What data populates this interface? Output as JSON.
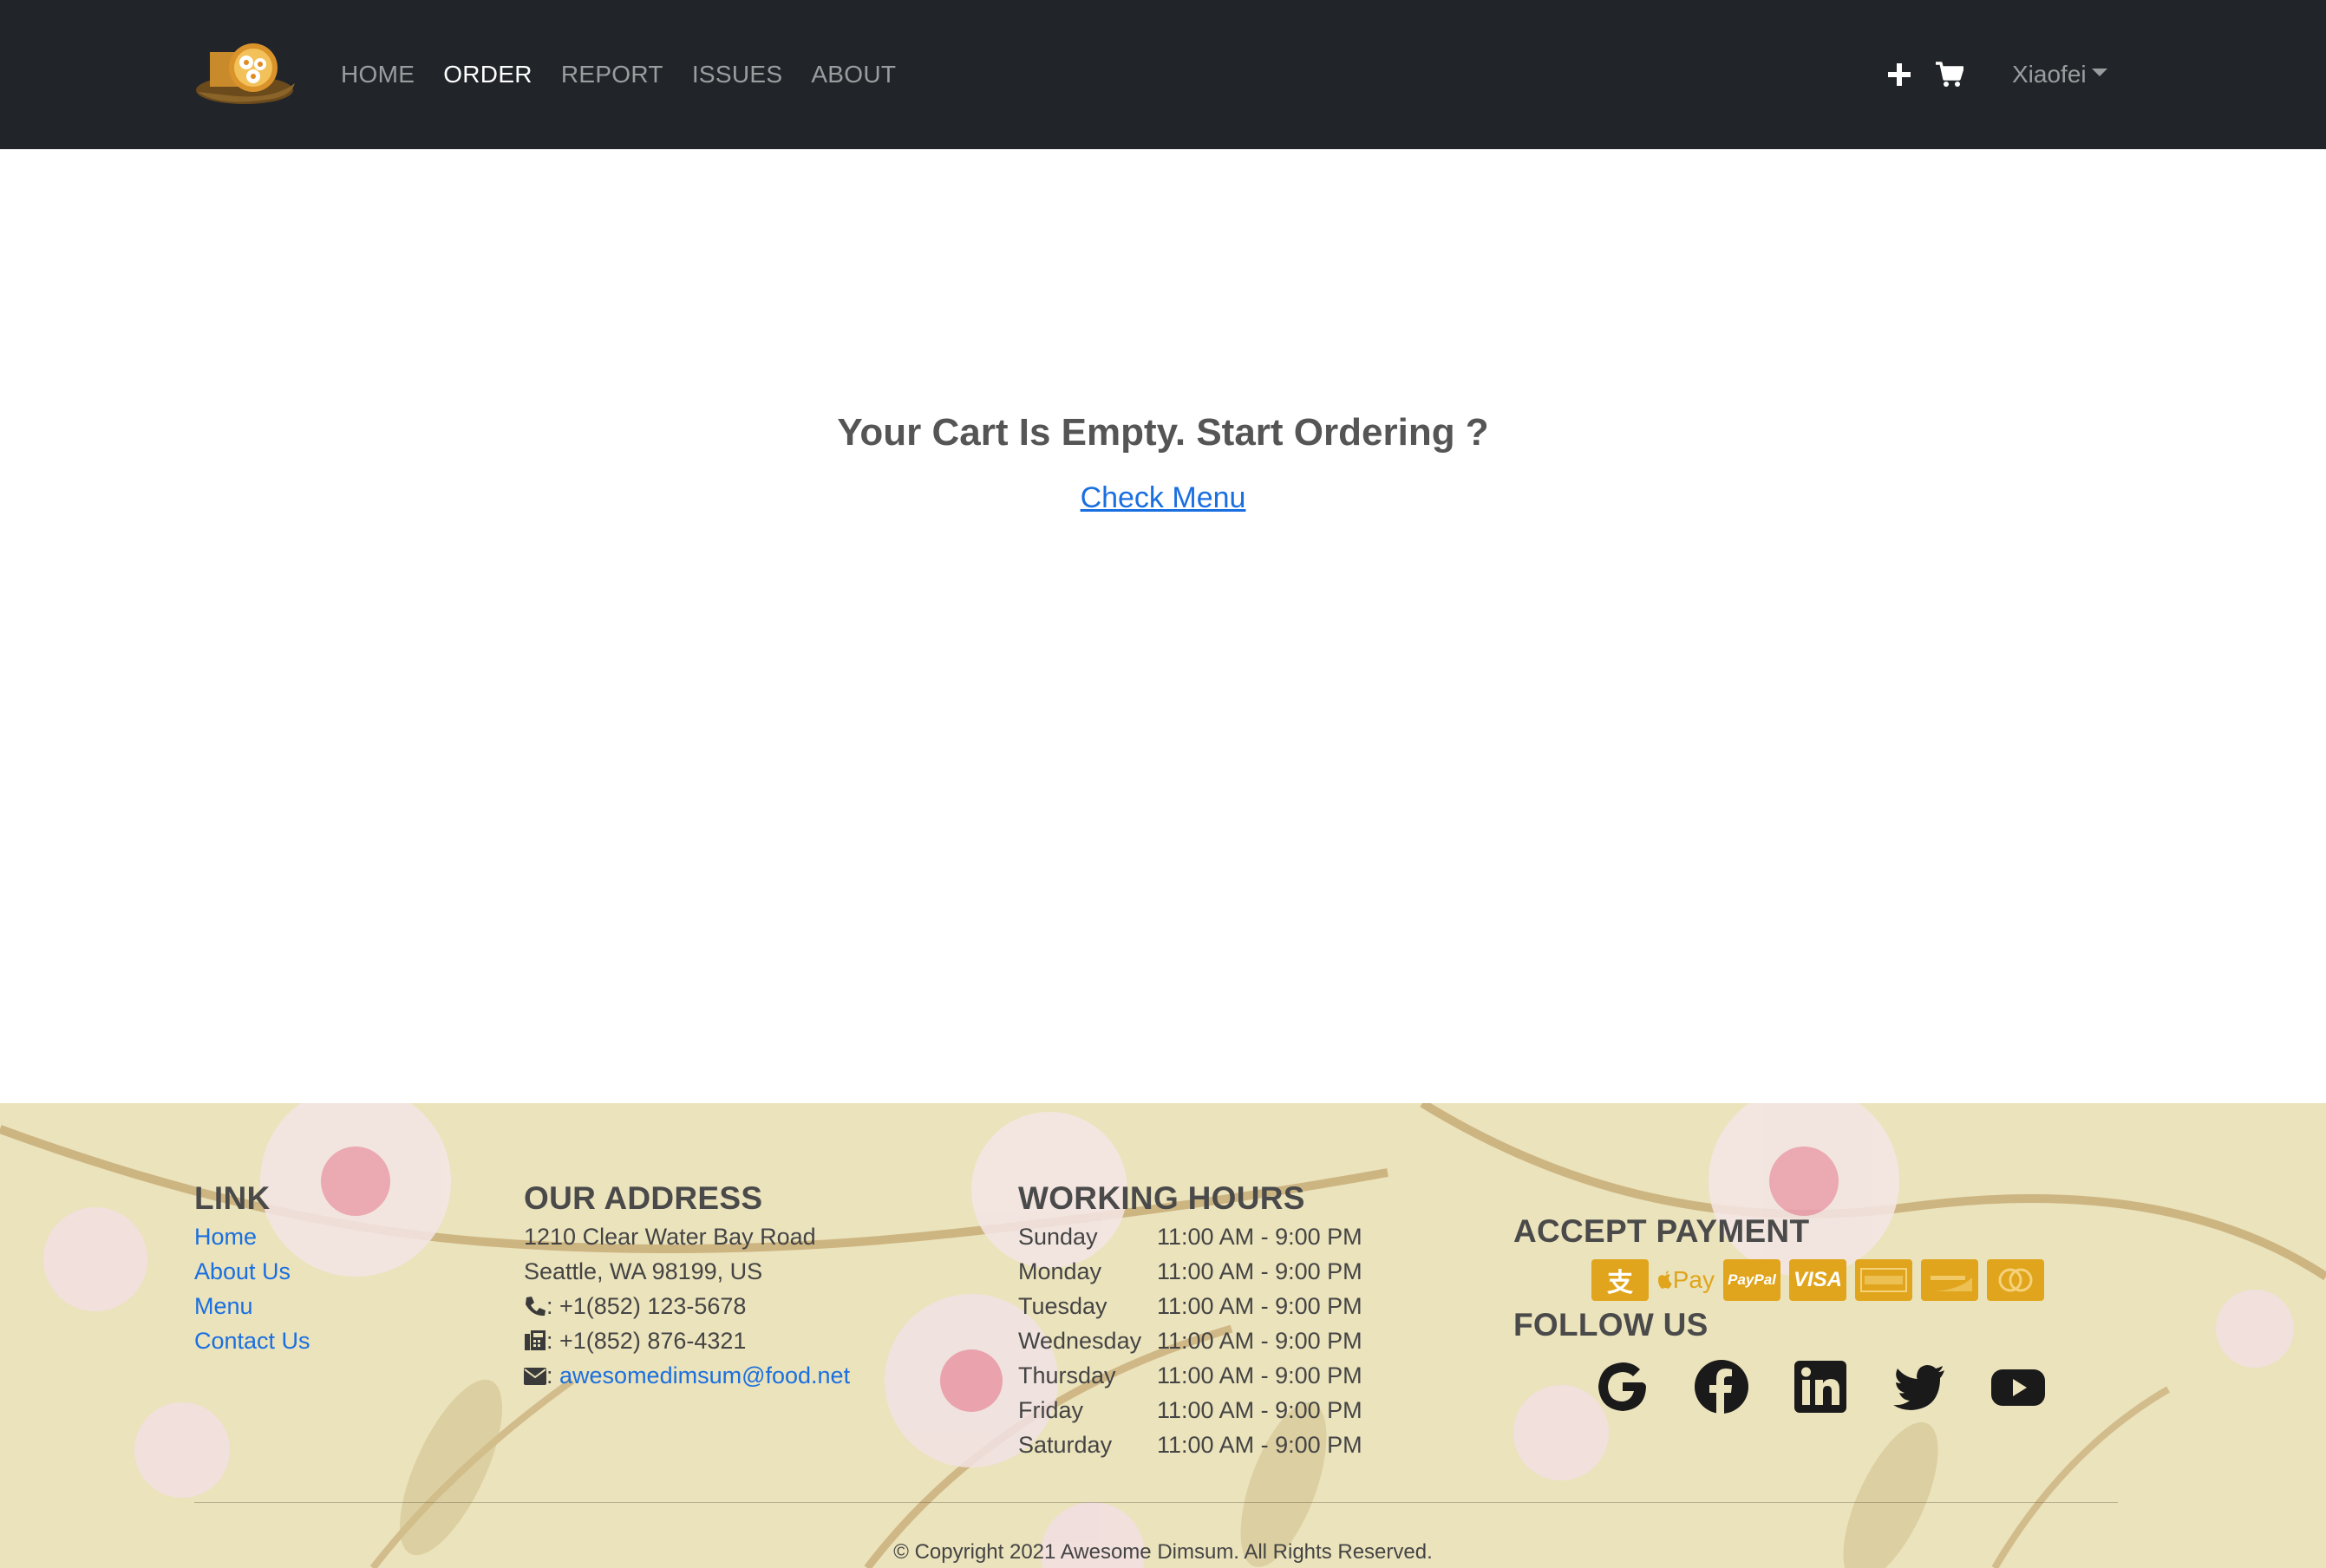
{
  "navbar": {
    "logo_alt": "Awesome Dimsum logo",
    "links": [
      {
        "label": "HOME",
        "active": false
      },
      {
        "label": "ORDER",
        "active": true
      },
      {
        "label": "REPORT",
        "active": false
      },
      {
        "label": "ISSUES",
        "active": false
      },
      {
        "label": "ABOUT",
        "active": false
      }
    ],
    "add_icon": "plus-icon",
    "cart_icon": "cart-icon",
    "user_name": "Xiaofei"
  },
  "main": {
    "empty_title": "Your Cart Is Empty. Start Ordering ?",
    "check_menu_label": "Check Menu"
  },
  "footer": {
    "link": {
      "heading": "LINK",
      "items": [
        "Home",
        "About Us",
        "Menu",
        "Contact Us"
      ]
    },
    "address": {
      "heading": "OUR ADDRESS",
      "street": "1210 Clear Water Bay Road",
      "city": "Seattle, WA 98199, US",
      "phone": ": +1(852) 123-5678",
      "fax": ": +1(852) 876-4321",
      "email_prefix": ": ",
      "email": "awesomedimsum@food.net"
    },
    "hours": {
      "heading": "WORKING HOURS",
      "rows": [
        {
          "day": "Sunday",
          "time": "11:00 AM - 9:00 PM"
        },
        {
          "day": "Monday",
          "time": "11:00 AM - 9:00 PM"
        },
        {
          "day": "Tuesday",
          "time": "11:00 AM - 9:00 PM"
        },
        {
          "day": "Wednesday",
          "time": "11:00 AM - 9:00 PM"
        },
        {
          "day": "Thursday",
          "time": "11:00 AM - 9:00 PM"
        },
        {
          "day": "Friday",
          "time": "11:00 AM - 9:00 PM"
        },
        {
          "day": "Saturday",
          "time": "11:00 AM - 9:00 PM"
        }
      ]
    },
    "payment": {
      "heading": "ACCEPT PAYMENT",
      "methods": [
        "alipay-icon",
        "apple-pay-icon",
        "paypal-icon",
        "visa-icon",
        "amex-icon",
        "discover-icon",
        "mastercard-icon"
      ],
      "paypal_label": "PayPal",
      "visa_label": "VISA",
      "applepay_label": "Pay"
    },
    "follow": {
      "heading": "FOLLOW US",
      "icons": [
        "google-icon",
        "facebook-icon",
        "linkedin-icon",
        "twitter-icon",
        "youtube-icon"
      ]
    },
    "copyright": "© Copyright 2021 Awesome Dimsum. All Rights Reserved.",
    "accent_color": "#e0a51c"
  }
}
